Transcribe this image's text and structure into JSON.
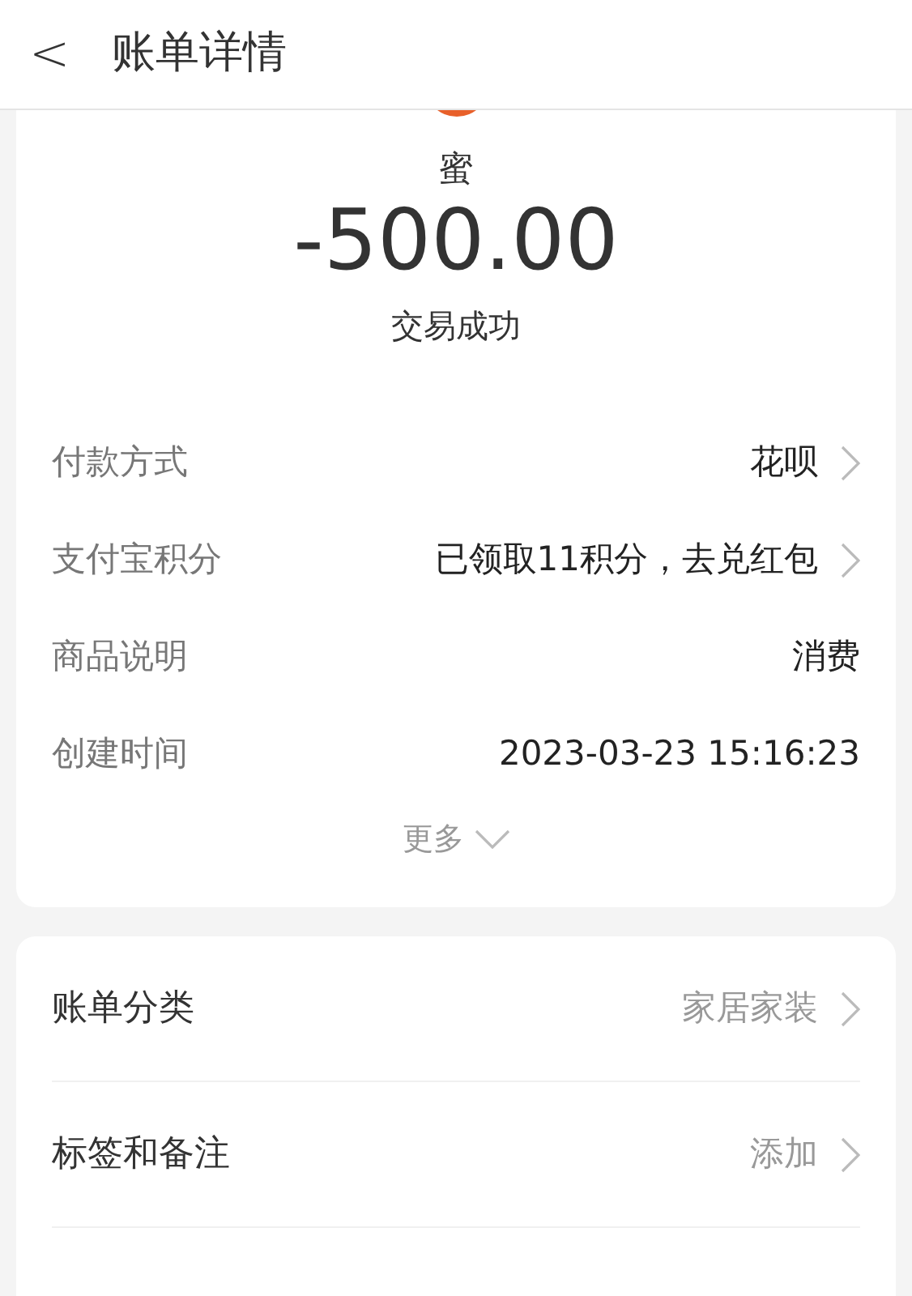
{
  "header": {
    "back": "<",
    "title": "账单详情"
  },
  "summary": {
    "merchant": "蜜",
    "amount": "-500.00",
    "status": "交易成功"
  },
  "details": [
    {
      "label": "付款方式",
      "value": "花呗",
      "arrow": true
    },
    {
      "label": "支付宝积分",
      "value": "已领取11积分，去兑红包",
      "arrow": true
    },
    {
      "label": "商品说明",
      "value": "消费",
      "arrow": false
    },
    {
      "label": "创建时间",
      "value": "2023-03-23 15:16:23",
      "arrow": false
    }
  ],
  "more": {
    "label": "更多",
    "expanded": false
  },
  "settings": [
    {
      "label": "账单分类",
      "value": "家居家装",
      "arrow": true
    },
    {
      "label": "标签和备注",
      "value": "添加",
      "arrow": true
    }
  ]
}
